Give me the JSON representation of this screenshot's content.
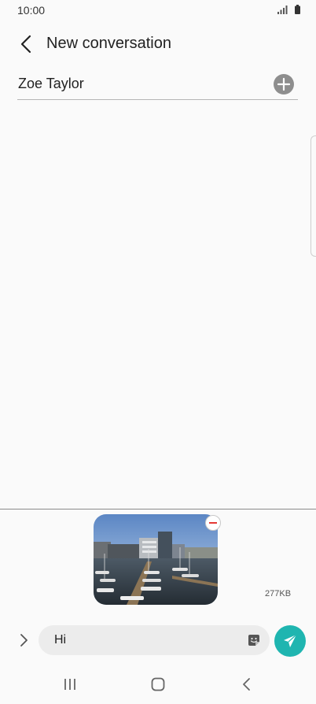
{
  "status": {
    "time": "10:00"
  },
  "header": {
    "title": "New conversation"
  },
  "recipient": {
    "name": "Zoe Taylor"
  },
  "compose": {
    "size_label": "277KB",
    "message_text": "Hi"
  },
  "icons": {
    "back": "chevron-left-icon",
    "add": "plus-icon",
    "remove": "minus-icon",
    "expand": "chevron-right-icon",
    "sticker": "sticker-icon",
    "send": "paper-plane-icon",
    "nav": [
      "recent-apps-icon",
      "home-icon",
      "back-icon"
    ]
  },
  "colors": {
    "accent": "#1fb5b0",
    "remove": "#e53935",
    "add_button": "#8e8e8e"
  }
}
